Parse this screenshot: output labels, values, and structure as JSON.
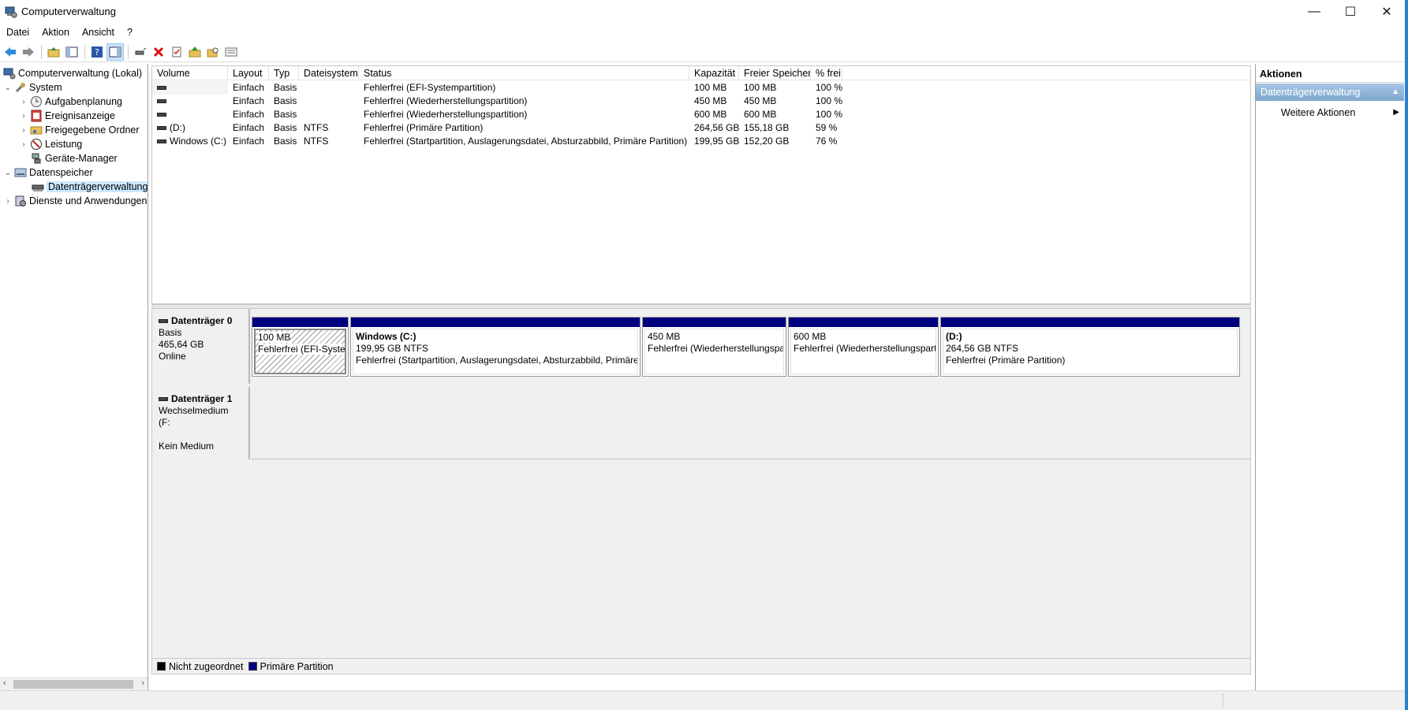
{
  "window": {
    "title": "Computerverwaltung",
    "minimize_glyph": "—",
    "maximize_glyph": "☐",
    "close_glyph": "✕"
  },
  "menubar": [
    "Datei",
    "Aktion",
    "Ansicht",
    "?"
  ],
  "toolbar": {
    "icons": [
      "back-icon",
      "forward-icon",
      "up-folder-icon",
      "show-hide-tree-icon",
      "help-icon",
      "show-hide-action-pane-icon",
      "connect-drive-icon",
      "delete-icon",
      "properties-icon",
      "folder-up-icon",
      "search-folder-icon",
      "list-view-icon"
    ]
  },
  "tree": {
    "root": "Computerverwaltung (Lokal)",
    "system": "System",
    "aufgabenplanung": "Aufgabenplanung",
    "ereignisanzeige": "Ereignisanzeige",
    "freigegebene_ordner": "Freigegebene Ordner",
    "leistung": "Leistung",
    "geraete_manager": "Geräte-Manager",
    "datenspeicher": "Datenspeicher",
    "datentraegerverwaltung": "Datenträgerverwaltung",
    "dienste": "Dienste und Anwendungen",
    "expand_open": "⌄",
    "expand_closed": "›"
  },
  "volume_list": {
    "columns": [
      "Volume",
      "Layout",
      "Typ",
      "Dateisystem",
      "Status",
      "Kapazität",
      "Freier Speicher",
      "% frei"
    ],
    "rows": [
      {
        "volume": "",
        "layout": "Einfach",
        "typ": "Basis",
        "fs": "",
        "status": "Fehlerfrei (EFI-Systempartition)",
        "kap": "100 MB",
        "frei": "100 MB",
        "pct": "100 %"
      },
      {
        "volume": "",
        "layout": "Einfach",
        "typ": "Basis",
        "fs": "",
        "status": "Fehlerfrei (Wiederherstellungspartition)",
        "kap": "450 MB",
        "frei": "450 MB",
        "pct": "100 %"
      },
      {
        "volume": "",
        "layout": "Einfach",
        "typ": "Basis",
        "fs": "",
        "status": "Fehlerfrei (Wiederherstellungspartition)",
        "kap": "600 MB",
        "frei": "600 MB",
        "pct": "100 %"
      },
      {
        "volume": "(D:)",
        "layout": "Einfach",
        "typ": "Basis",
        "fs": "NTFS",
        "status": "Fehlerfrei (Primäre Partition)",
        "kap": "264,56 GB",
        "frei": "155,18 GB",
        "pct": "59 %"
      },
      {
        "volume": "Windows (C:)",
        "layout": "Einfach",
        "typ": "Basis",
        "fs": "NTFS",
        "status": "Fehlerfrei (Startpartition, Auslagerungsdatei, Absturzabbild, Primäre Partition)",
        "kap": "199,95 GB",
        "frei": "152,20 GB",
        "pct": "76 %"
      }
    ]
  },
  "disks": {
    "disk0": {
      "name": "Datenträger 0",
      "type": "Basis",
      "size": "465,64 GB",
      "state": "Online",
      "partitions": [
        {
          "title": "",
          "size": "100 MB",
          "status": "Fehlerfrei (EFI-Systempa"
        },
        {
          "title": "Windows  (C:)",
          "size": "199,95 GB NTFS",
          "status": "Fehlerfrei (Startpartition, Auslagerungsdatei, Absturzabbild, Primäre"
        },
        {
          "title": "",
          "size": "450 MB",
          "status": "Fehlerfrei (Wiederherstellungspa"
        },
        {
          "title": "",
          "size": "600 MB",
          "status": "Fehlerfrei (Wiederherstellungspart"
        },
        {
          "title": "(D:)",
          "size": "264,56 GB NTFS",
          "status": "Fehlerfrei (Primäre Partition)"
        }
      ]
    },
    "disk1": {
      "name": "Datenträger 1",
      "type": "Wechselmedium (F:",
      "state": "Kein Medium"
    }
  },
  "legend": [
    {
      "label": "Nicht zugeordnet",
      "color": "#000000"
    },
    {
      "label": "Primäre Partition",
      "color": "#00007f"
    }
  ],
  "actions": {
    "header": "Aktionen",
    "section": "Datenträgerverwaltung",
    "section_caret": "▲",
    "item": "Weitere Aktionen",
    "item_arrow": "▶"
  },
  "scroll": {
    "left": "‹",
    "right": "›"
  }
}
